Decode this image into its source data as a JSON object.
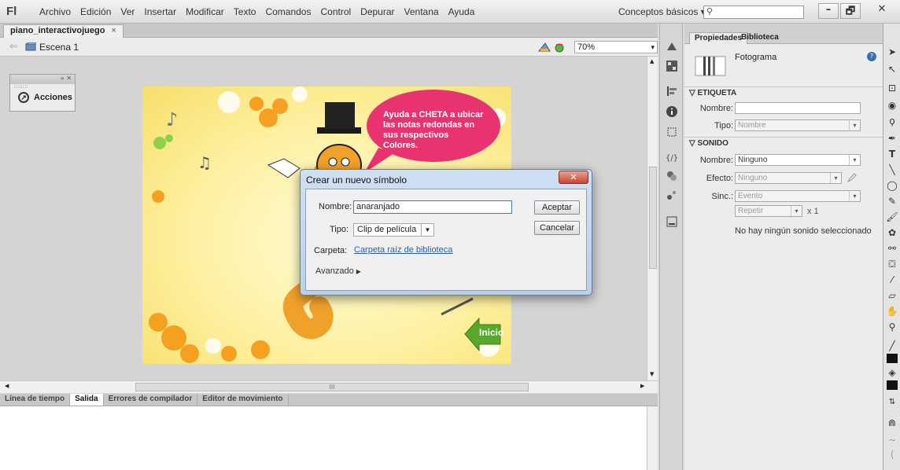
{
  "app": {
    "logo": "Fl",
    "menu": [
      "Archivo",
      "Edición",
      "Ver",
      "Insertar",
      "Modificar",
      "Texto",
      "Comandos",
      "Control",
      "Depurar",
      "Ventana",
      "Ayuda"
    ],
    "workspace": "Conceptos básicos",
    "workspace_arrow": "▾",
    "window_buttons": [
      "–",
      "🗗",
      "✕"
    ]
  },
  "document": {
    "tab_label": "piano_interactivojuego",
    "tab_close": "×",
    "back_arrow": "⇐",
    "scene_label": "Escena 1",
    "zoom": "70%",
    "zoom_arrow": "▾"
  },
  "actions_panel": {
    "header": "» ✕",
    "button_label": "Acciones"
  },
  "stage": {
    "speech_text": "Ayuda a CHETA a ubicar las notas redondas en sus respectivos Colores.",
    "home_button": "Inicio",
    "colors": {
      "bubble": "#e83370",
      "arrow": "#5aa82a",
      "flower": "#f5a020"
    }
  },
  "bottom_panel": {
    "tabs": [
      "Línea de tiempo",
      "Salida",
      "Errores de compilador",
      "Editor de movimiento"
    ],
    "active_tab": "Salida"
  },
  "properties": {
    "tabs": [
      "Propiedades",
      "Biblioteca"
    ],
    "frame_label": "Fotograma",
    "sections": {
      "etiqueta": {
        "title": "ETIQUETA",
        "name_label": "Nombre:",
        "name_value": "",
        "type_label": "Tipo:",
        "type_value": "Nombre"
      },
      "sonido": {
        "title": "SONIDO",
        "name_label": "Nombre:",
        "name_value": "Ninguno",
        "effect_label": "Efecto:",
        "effect_value": "Ninguno",
        "sync_label": "Sinc.:",
        "sync_value": "Evento",
        "repeat_value": "Repetir",
        "repeat_count": "x 1",
        "status": "No hay ningún sonido seleccionado"
      }
    }
  },
  "dialog": {
    "title": "Crear un nuevo símbolo",
    "close": "✕",
    "name_label": "Nombre:",
    "name_value": "anaranjado",
    "type_label": "Tipo:",
    "type_value": "Clip de película",
    "folder_label": "Carpeta:",
    "folder_value": "Carpeta raíz de biblioteca",
    "advanced_label": "Avanzado",
    "ok": "Aceptar",
    "cancel": "Cancelar"
  }
}
